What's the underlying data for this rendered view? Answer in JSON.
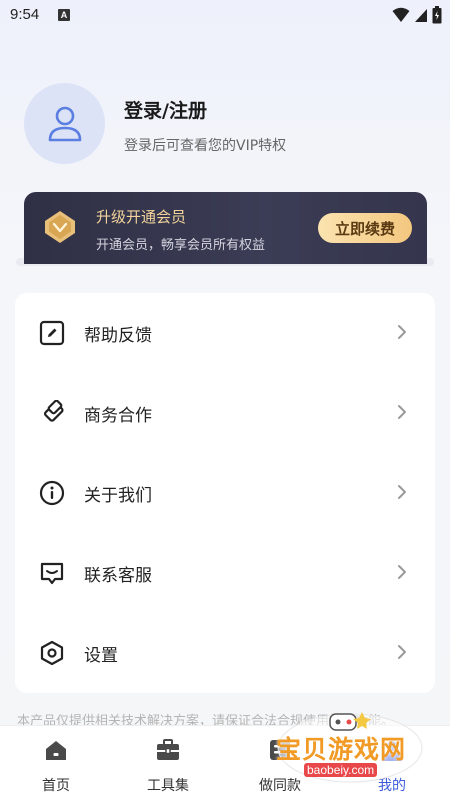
{
  "status_bar": {
    "time": "9:54",
    "notification_icon": "A",
    "icons": [
      "wifi-icon",
      "signal-icon",
      "battery-icon"
    ]
  },
  "profile": {
    "avatar_icon": "user-icon",
    "title": "登录/注册",
    "subtitle": "登录后可查看您的VIP特权"
  },
  "vip": {
    "icon": "diamond-badge-icon",
    "title": "升级开通会员",
    "subtitle": "开通会员，畅享会员所有权益",
    "button_label": "立即续费",
    "colors": {
      "card": "#2f3045",
      "gold": "#f2d49a",
      "button": "#f3c77f"
    }
  },
  "menu": {
    "items": [
      {
        "label": "帮助反馈",
        "icon": "edit-icon"
      },
      {
        "label": "商务合作",
        "icon": "cooperation-icon"
      },
      {
        "label": "关于我们",
        "icon": "info-icon"
      },
      {
        "label": "联系客服",
        "icon": "chat-icon"
      },
      {
        "label": "设置",
        "icon": "settings-icon"
      }
    ]
  },
  "footer_text": "本产品仅提供相关技术解决方案，请保证合法合规使用相关功能。",
  "tabs": [
    {
      "label": "首页",
      "icon": "home-icon",
      "active": false
    },
    {
      "label": "工具集",
      "icon": "toolbox-icon",
      "active": false
    },
    {
      "label": "做同款",
      "icon": "template-icon",
      "active": false
    },
    {
      "label": "我的",
      "icon": "profile-icon",
      "active": true
    }
  ],
  "watermark": {
    "text": "宝贝游戏网",
    "url": "baobeiy.com"
  },
  "colors": {
    "accent": "#3b5bdb",
    "background": "#f5f6f8"
  }
}
